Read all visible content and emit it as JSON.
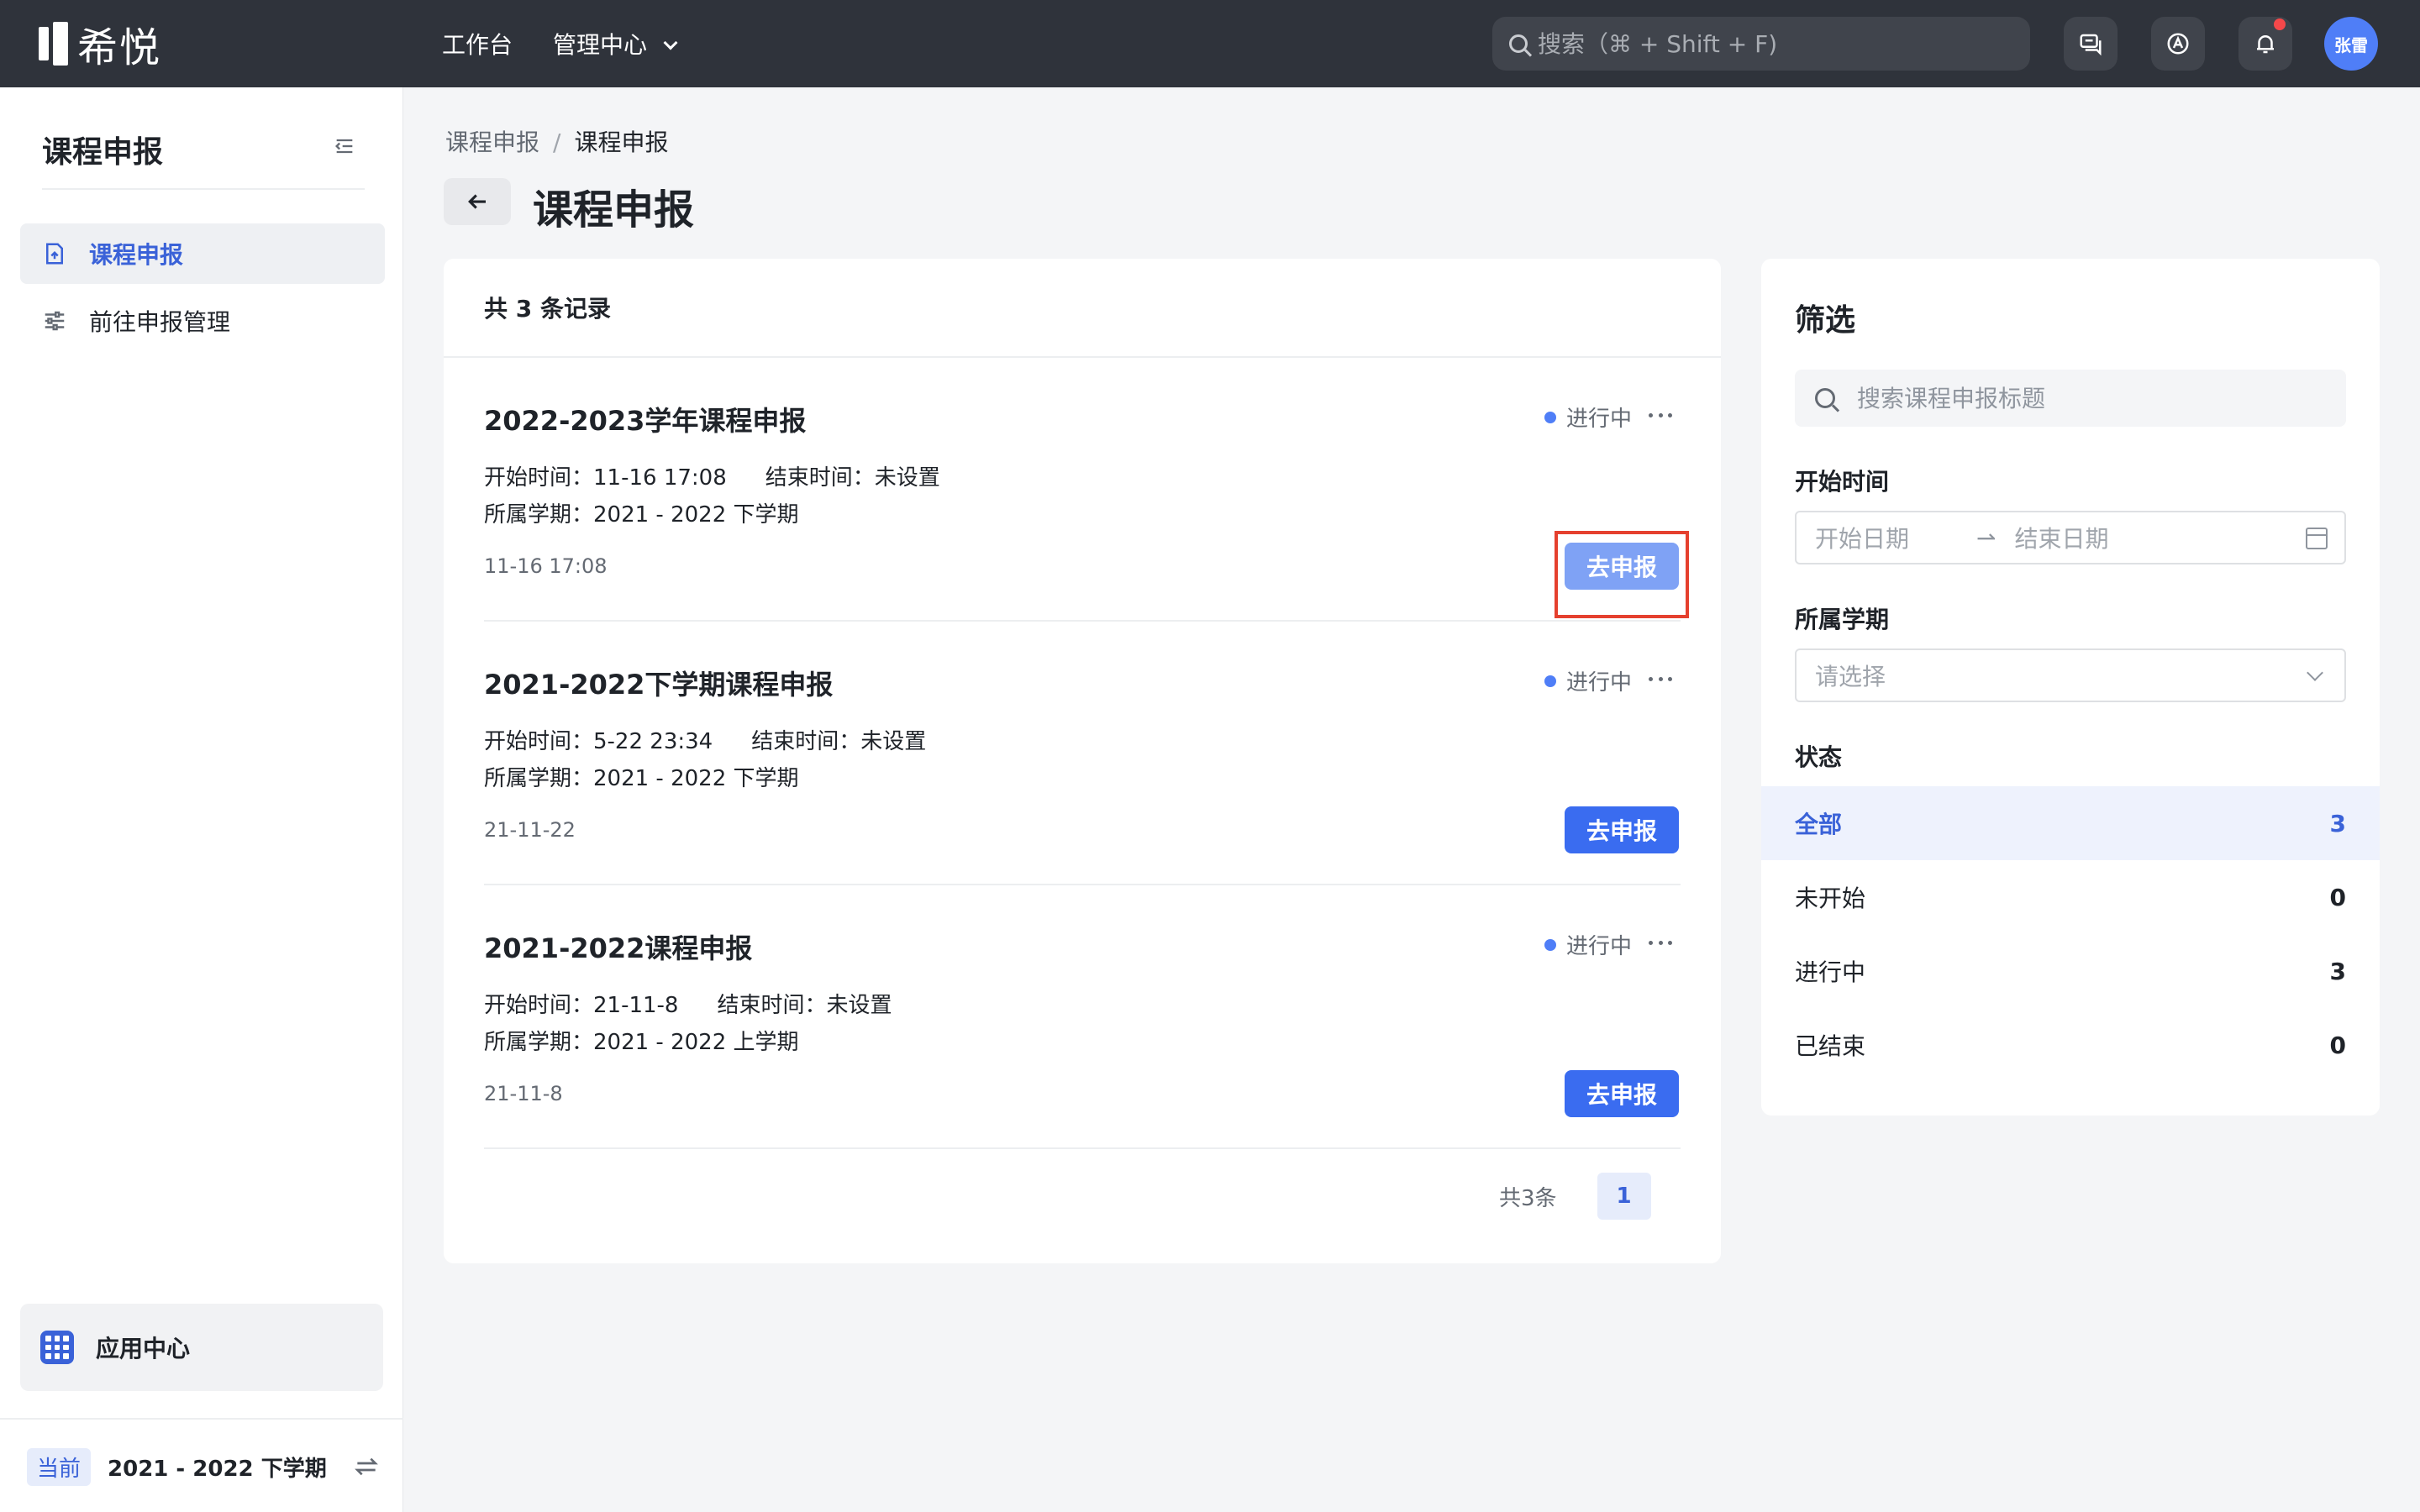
{
  "topbar": {
    "logo_text": "希悦",
    "nav": [
      "工作台",
      "管理中心"
    ],
    "search_placeholder": "搜索（⌘ + Shift + F)",
    "avatar_text": "张雷"
  },
  "sidebar": {
    "title": "课程申报",
    "items": [
      {
        "label": "课程申报"
      },
      {
        "label": "前往申报管理"
      }
    ],
    "app_center": "应用中心",
    "term_badge": "当前",
    "term_label": "2021 - 2022 下学期"
  },
  "main": {
    "breadcrumb": [
      "课程申报",
      "课程申报"
    ],
    "title": "课程申报",
    "records_count": "共 3 条记录",
    "records": [
      {
        "title": "2022-2023学年课程申报",
        "status": "进行中",
        "start": "开始时间：11-16 17:08",
        "end": "结束时间：未设置",
        "term": "所属学期：2021 - 2022 下学期",
        "date": "11-16 17:08",
        "button": "去申报"
      },
      {
        "title": "2021-2022下学期课程申报",
        "status": "进行中",
        "start": "开始时间：5-22 23:34",
        "end": "结束时间：未设置",
        "term": "所属学期：2021 - 2022 下学期",
        "date": "21-11-22",
        "button": "去申报"
      },
      {
        "title": "2021-2022课程申报",
        "status": "进行中",
        "start": "开始时间：21-11-8",
        "end": "结束时间：未设置",
        "term": "所属学期：2021 - 2022 上学期",
        "date": "21-11-8",
        "button": "去申报"
      }
    ],
    "pager_total": "共3条",
    "pager_page": "1"
  },
  "filter": {
    "title": "筛选",
    "search_placeholder": "搜索课程申报标题",
    "start_label": "开始时间",
    "date_start_placeholder": "开始日期",
    "date_end_placeholder": "结束日期",
    "term_label": "所属学期",
    "term_placeholder": "请选择",
    "status_label": "状态",
    "statuses": [
      {
        "label": "全部",
        "count": "3"
      },
      {
        "label": "未开始",
        "count": "0"
      },
      {
        "label": "进行中",
        "count": "3"
      },
      {
        "label": "已结束",
        "count": "0"
      }
    ]
  },
  "colors": {
    "topbar_bg": "#2f333b",
    "accent": "#3a6cf0",
    "highlight": "#e5402e"
  }
}
